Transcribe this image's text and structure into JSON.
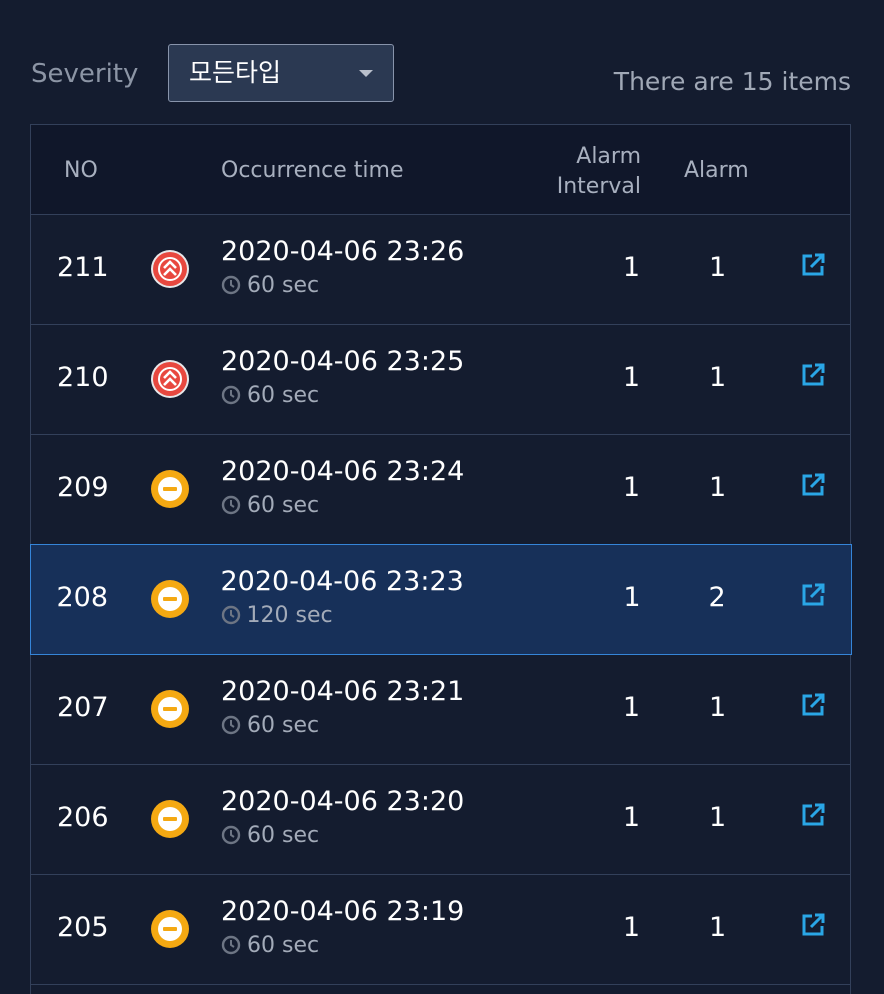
{
  "filter": {
    "label": "Severity",
    "selected": "모든타입",
    "count_text": "There are 15 items"
  },
  "table": {
    "columns": {
      "no": "NO",
      "time": "Occurrence time",
      "interval": "Alarm\nInterval",
      "alarm": "Alarm"
    },
    "rows": [
      {
        "no": "211",
        "severity": "critical-chevron-up-icon",
        "time": "2020-04-06 23:26",
        "duration": "60 sec",
        "interval": "1",
        "alarm": "1",
        "selected": false
      },
      {
        "no": "210",
        "severity": "critical-chevron-up-icon",
        "time": "2020-04-06 23:25",
        "duration": "60 sec",
        "interval": "1",
        "alarm": "1",
        "selected": false
      },
      {
        "no": "209",
        "severity": "warning-minus-icon",
        "time": "2020-04-06 23:24",
        "duration": "60 sec",
        "interval": "1",
        "alarm": "1",
        "selected": false
      },
      {
        "no": "208",
        "severity": "warning-minus-icon",
        "time": "2020-04-06 23:23",
        "duration": "120 sec",
        "interval": "1",
        "alarm": "2",
        "selected": true
      },
      {
        "no": "207",
        "severity": "warning-minus-icon",
        "time": "2020-04-06 23:21",
        "duration": "60 sec",
        "interval": "1",
        "alarm": "1",
        "selected": false
      },
      {
        "no": "206",
        "severity": "warning-minus-icon",
        "time": "2020-04-06 23:20",
        "duration": "60 sec",
        "interval": "1",
        "alarm": "1",
        "selected": false
      },
      {
        "no": "205",
        "severity": "warning-minus-icon",
        "time": "2020-04-06 23:19",
        "duration": "60 sec",
        "interval": "1",
        "alarm": "1",
        "selected": false
      }
    ]
  },
  "colors": {
    "critical": "#e8483f",
    "warning": "#f5a912",
    "accent": "#2aa6e6",
    "selected_border": "#3585d9"
  }
}
